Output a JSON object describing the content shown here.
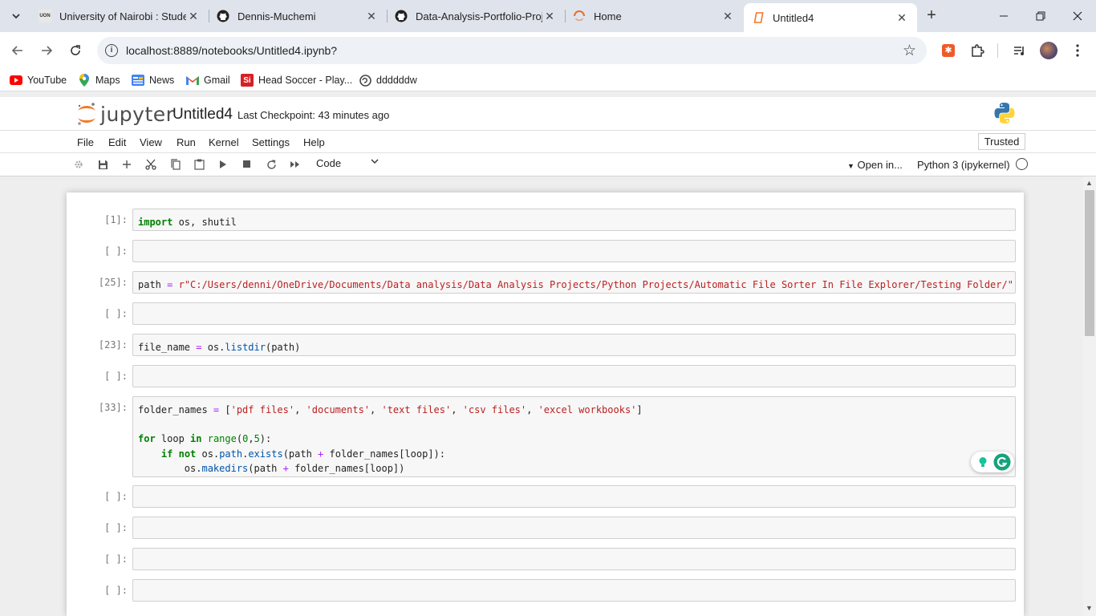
{
  "browser": {
    "tabs": [
      {
        "title": "University of Nairobi : Studer",
        "favicon": "uon-logo"
      },
      {
        "title": "Dennis-Muchemi",
        "favicon": "github-icon"
      },
      {
        "title": "Data-Analysis-Portfolio-Proj",
        "favicon": "github-icon"
      },
      {
        "title": "Home",
        "favicon": "jupyter-spinner-icon"
      },
      {
        "title": "Untitled4",
        "favicon": "notebook-icon"
      }
    ],
    "url": "localhost:8889/notebooks/Untitled4.ipynb?",
    "bookmarks": [
      "YouTube",
      "Maps",
      "News",
      "Gmail",
      "Head Soccer - Play...",
      "ddddddw"
    ]
  },
  "jupyter": {
    "logo_text": "jupyter",
    "notebook_name": "Untitled4",
    "checkpoint": "Last Checkpoint: 43 minutes ago",
    "menu": [
      "File",
      "Edit",
      "View",
      "Run",
      "Kernel",
      "Settings",
      "Help"
    ],
    "trusted": "Trusted",
    "cell_type": "Code",
    "open_in": "Open in...",
    "kernel": "Python 3 (ipykernel)"
  },
  "cells": [
    {
      "prompt": "[1]:"
    },
    {
      "prompt": "[ ]:"
    },
    {
      "prompt": "[25]:"
    },
    {
      "prompt": "[ ]:"
    },
    {
      "prompt": "[23]:"
    },
    {
      "prompt": "[ ]:"
    },
    {
      "prompt": "[33]:"
    },
    {
      "prompt": "[ ]:"
    },
    {
      "prompt": "[ ]:"
    },
    {
      "prompt": "[ ]:"
    },
    {
      "prompt": "[ ]:"
    }
  ],
  "code": {
    "c1": {
      "kw_import": "import",
      "rest": " os, shutil"
    },
    "c3": {
      "pre": "path ",
      "eq": "=",
      "mid": " ",
      "str": "r\"C:/Users/denni/OneDrive/Documents/Data analysis/Data Analysis Projects/Python Projects/Automatic File Sorter In File Explorer/Testing Folder/\""
    },
    "c5": {
      "pre": "file_name ",
      "eq": "=",
      "obj": " os.",
      "fn": "listdir",
      "args": "(path)"
    },
    "c7": {
      "l1_pre": "folder_names ",
      "eq": "=",
      "l1_open": " [",
      "s1": "'pdf files'",
      "s2": "'documents'",
      "s3": "'text files'",
      "s4": "'csv files'",
      "s5": "'excel workbooks'",
      "comma": ", ",
      "l1_close": "]",
      "l2_for": "for",
      "l2_var": " loop ",
      "l2_in": "in",
      "l2_sp": " ",
      "l2_range": "range",
      "l2_open": "(",
      "l2_n0": "0",
      "l2_c": ",",
      "l2_n5": "5",
      "l2_close": "):",
      "l3_ind": "    ",
      "l3_if": "if",
      "l3_sp": " ",
      "l3_not": "not",
      "l3_os": " os.",
      "l3_path": "path",
      "l3_dot": ".",
      "l3_exists": "exists",
      "l3_args1": "(path ",
      "l3_plus": "+",
      "l3_args2": " folder_names[loop]):",
      "l4_ind": "        os.",
      "l4_fn": "makedirs",
      "l4_args1": "(path ",
      "l4_plus": "+",
      "l4_args2": " folder_names[loop])"
    }
  }
}
